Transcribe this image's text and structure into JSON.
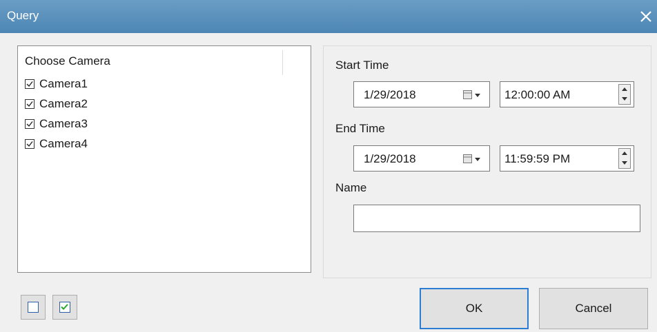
{
  "window": {
    "title": "Query",
    "close_icon": "close-icon"
  },
  "cameras": {
    "header": "Choose Camera",
    "items": [
      {
        "label": "Camera1",
        "checked": true
      },
      {
        "label": "Camera2",
        "checked": true
      },
      {
        "label": "Camera3",
        "checked": true
      },
      {
        "label": "Camera4",
        "checked": true
      }
    ]
  },
  "start_time": {
    "label": "Start Time",
    "date": "1/29/2018",
    "time": "12:00:00 AM"
  },
  "end_time": {
    "label": "End Time",
    "date": "1/29/2018",
    "time": "11:59:59 PM"
  },
  "name": {
    "label": "Name",
    "value": ""
  },
  "buttons": {
    "ok": "OK",
    "cancel": "Cancel"
  },
  "icons": {
    "deselect_all": "empty-checkbox-icon",
    "select_all": "checked-checkbox-icon",
    "calendar": "calendar-dropdown-icon",
    "spinner": "spinner-icon"
  },
  "colors": {
    "titlebar": "#4d86b5",
    "accent": "#2b7cd3",
    "check": "#2aa52a"
  }
}
